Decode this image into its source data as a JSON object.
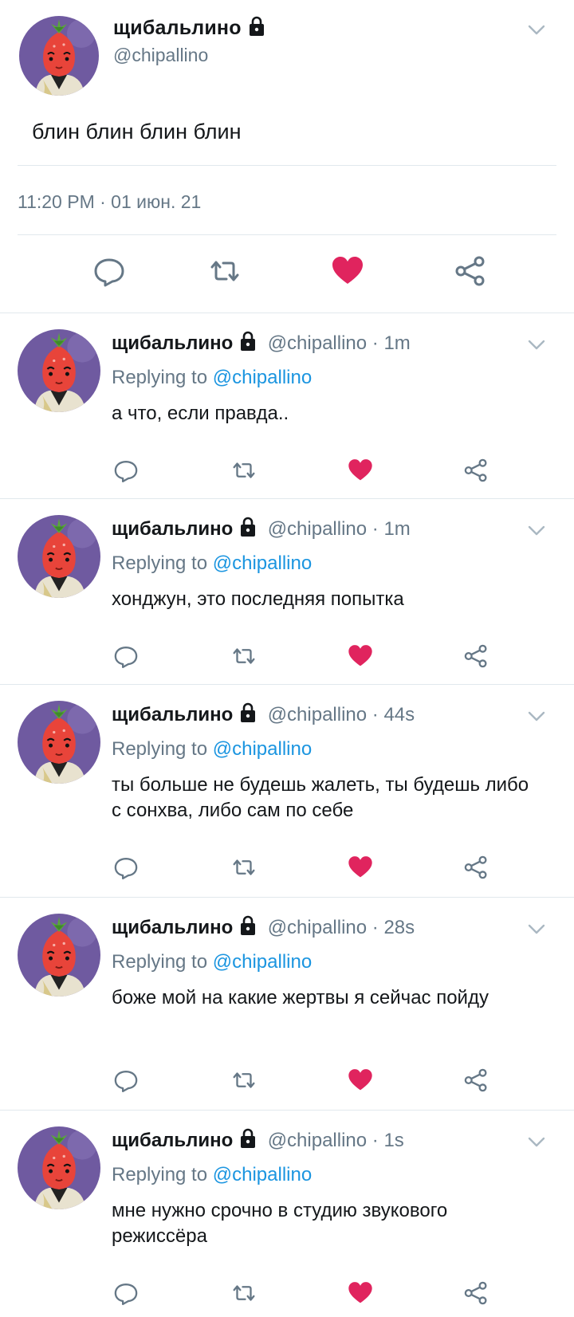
{
  "main_tweet": {
    "display_name": "щибальлино",
    "handle": "@chipallino",
    "text": "блин блин блин блин",
    "timestamp": "11:20 PM · 01 июн. 21",
    "liked": true
  },
  "replies": [
    {
      "display_name": "щибальлино",
      "meta": "@chipallino · 1m",
      "replying_label": "Replying to",
      "replying_to": "@chipallino",
      "text": "а что, если правда..",
      "liked": true
    },
    {
      "display_name": "щибальлино",
      "meta": "@chipallino · 1m",
      "replying_label": "Replying to",
      "replying_to": "@chipallino",
      "text": "хонджун, это последняя попытка",
      "liked": true
    },
    {
      "display_name": "щибальлино",
      "meta": "@chipallino · 44s",
      "replying_label": "Replying to",
      "replying_to": "@chipallino",
      "text": "ты больше не будешь жалеть, ты будешь либо с сонхва, либо сам по себе",
      "liked": true
    },
    {
      "display_name": "щибальлино",
      "meta": "@chipallino · 28s",
      "replying_label": "Replying to",
      "replying_to": "@chipallino",
      "text": "боже мой на какие жертвы я сейчас пойду",
      "liked": true
    },
    {
      "display_name": "щибальлино",
      "meta": "@chipallino · 1s",
      "replying_label": "Replying to",
      "replying_to": "@chipallino",
      "text": "мне нужно срочно в студию звукового режиссёра",
      "liked": true
    }
  ],
  "icons": {
    "lock": "lock-icon",
    "menu": "chevron-down-icon",
    "reply": "reply-icon",
    "retweet": "retweet-icon",
    "like": "heart-icon",
    "share": "share-icon"
  },
  "colors": {
    "text": "#14171a",
    "secondary": "#657786",
    "mention": "#1b95e0",
    "like": "#e0245e",
    "divider": "#e1e8ed",
    "avatar_bg": "#6f5aa0"
  }
}
